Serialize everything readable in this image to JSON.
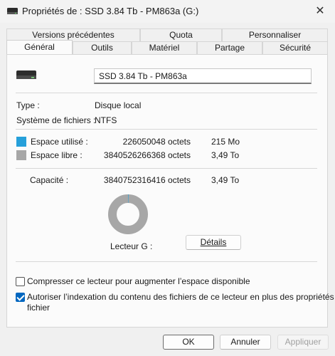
{
  "window": {
    "title": "Propriétés de : SSD 3.84 Tb - PM863a (G:)",
    "close_glyph": "✕"
  },
  "tabs_back": [
    "Versions précédentes",
    "Quota",
    "Personnaliser"
  ],
  "tabs_front": [
    "Général",
    "Outils",
    "Matériel",
    "Partage",
    "Sécurité"
  ],
  "active_tab": "Général",
  "general": {
    "drive_name": "SSD 3.84 Tb - PM863a",
    "type_label": "Type :",
    "type_value": "Disque local",
    "fs_label": "Système de fichiers :",
    "fs_value": "NTFS",
    "used_label": "Espace utilisé :",
    "used_bytes": "226050048 octets",
    "used_size": "215 Mo",
    "used_color": "#26a0da",
    "free_label": "Espace libre :",
    "free_bytes": "3840526266368 octets",
    "free_size": "3,49 To",
    "free_color": "#a7a7a7",
    "capacity_label": "Capacité :",
    "capacity_bytes": "3840752316416 octets",
    "capacity_size": "3,49 To",
    "drive_label": "Lecteur G :",
    "details_button": "Détails",
    "compress_label": "Compresser ce lecteur pour augmenter l’espace disponible",
    "compress_checked": false,
    "index_label_line1": "Autoriser l’indexation du contenu des fichiers de ce lecteur en plus des propriétés de",
    "index_label_line2": "fichier",
    "index_checked": true,
    "used_fraction": 5.89e-05
  },
  "buttons": {
    "ok": "OK",
    "cancel": "Annuler",
    "apply": "Appliquer"
  },
  "icons": {
    "title": "drive-icon",
    "close": "close-icon",
    "drive": "drive-icon",
    "check": "check-icon"
  }
}
